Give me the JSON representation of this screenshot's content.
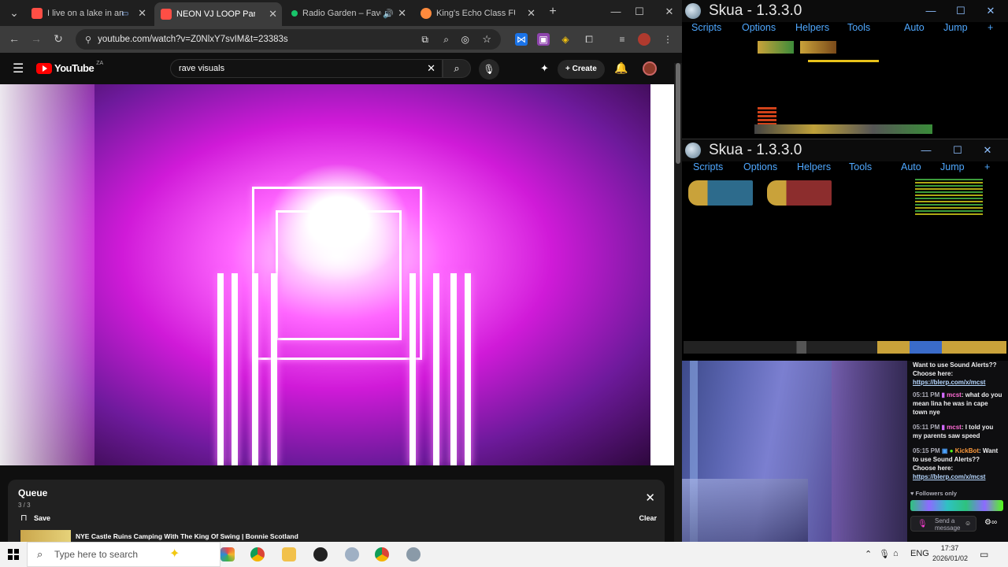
{
  "browser": {
    "tabs": [
      {
        "title": "I live on a lake in an u",
        "favicon_color": "#ff4e45"
      },
      {
        "title": "NEON VJ LOOP Party Ligh",
        "favicon_color": "#ff4e45"
      },
      {
        "title": "Radio Garden – Favo",
        "favicon_color": "#18c46a"
      },
      {
        "title": "King's Echo Class FULL G",
        "favicon_color": "#ff8a3d"
      }
    ],
    "new_tab": "+",
    "url": "youtube.com/watch?v=Z0NlxY7svIM&t=23383s"
  },
  "youtube": {
    "logo_text": "YouTube",
    "region": "ZA",
    "search_query": "rave visuals",
    "create_label": "Create"
  },
  "queue": {
    "title": "Queue",
    "position": "3 / 3",
    "save_label": "Save",
    "clear_label": "Clear",
    "current_item": "NYE Castle Ruins Camping With The King Of Swing | Bonnie Scotland"
  },
  "skua": {
    "title": "Skua - 1.3.3.0",
    "menu": {
      "scripts": "Scripts",
      "options": "Options",
      "helpers": "Helpers",
      "tools": "Tools",
      "auto": "Auto",
      "jump": "Jump",
      "add": "+"
    }
  },
  "chat": {
    "msg1_text": "Want to use Sound Alerts?? Choose here:",
    "msg1_link": "https://blerp.com/x/mcst",
    "msg2_time": "05:11 PM",
    "msg2_user": "mcst",
    "msg2_text": ": what do you mean lina he was in cape town nye",
    "msg3_time": "05:11 PM",
    "msg3_user": "mcst",
    "msg3_text": ": I told you my parents saw speed",
    "msg4_time": "05:15 PM",
    "msg4_user": "KickBot",
    "msg4_text": ": Want to use Sound Alerts?? Choose here:",
    "msg4_link": "https://blerp.com/x/mcst",
    "followers_only": "Followers only",
    "send_placeholder": "Send a message"
  },
  "taskbar": {
    "search_placeholder": "Type here to search",
    "language": "ENG",
    "time": "17:37",
    "date": "2026/01/02"
  },
  "colors": {
    "chrome_bg": "#1f1f1f",
    "youtube_red": "#ff0000",
    "skua_blue": "#4fa8ff",
    "kick_green": "#53fc18"
  }
}
